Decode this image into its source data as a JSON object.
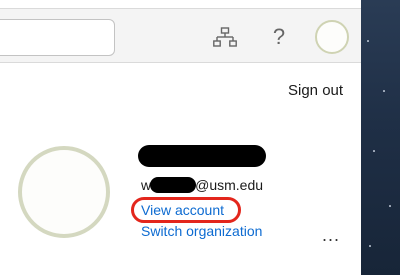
{
  "topbar": {
    "search": {
      "placeholder": "",
      "value": ""
    },
    "icons": {
      "org": "org-chart-icon",
      "help": "help-icon",
      "help_glyph": "?",
      "account": "account-avatar"
    }
  },
  "account": {
    "sign_out_label": "Sign out",
    "email_prefix": "w",
    "email_suffix": "@usm.edu",
    "view_account_label": "View account",
    "switch_org_label": "Switch organization",
    "more_glyph": "..."
  },
  "colors": {
    "link": "#0d6bd1",
    "highlight_ring": "#e3261c",
    "topbar_bg": "#f4f4f4",
    "background_sky": "#1f2f46"
  }
}
